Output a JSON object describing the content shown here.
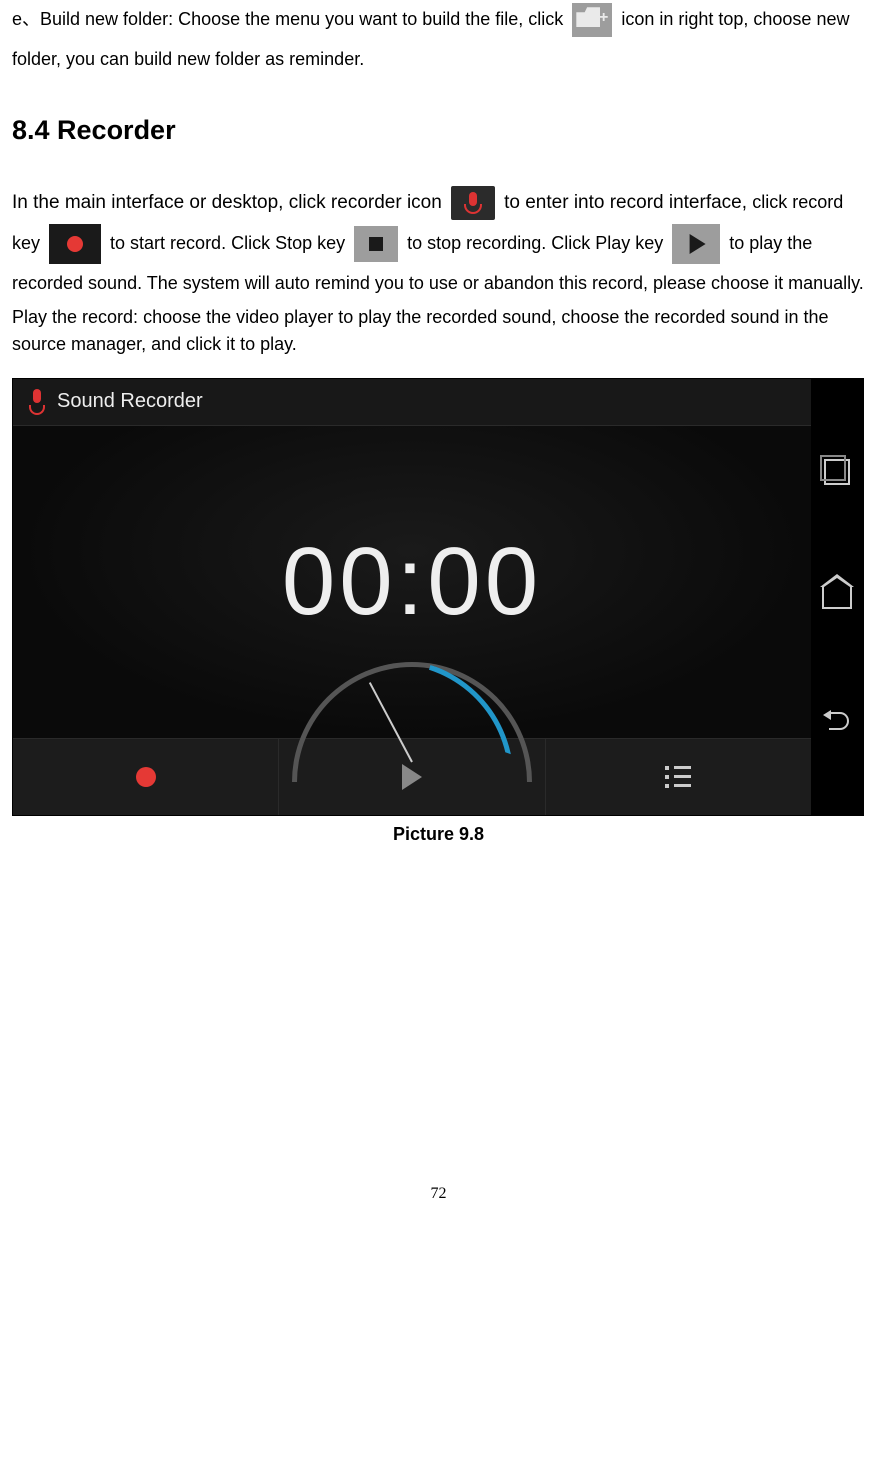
{
  "intro": {
    "prefix": "e、Build new folder: Choose the menu you want to build the file, click ",
    "suffix": " icon in right top, choose new folder, you can build new folder as reminder."
  },
  "heading": "8.4 Recorder",
  "body": {
    "p1a": "In the main interface or desktop, click recorder icon ",
    "p1b": " to enter into record interface, ",
    "p1c": "click record key ",
    "p1d": " to start record. Click Stop key ",
    "p1e": " to stop recording. Click Play key ",
    "p1f": " to play the recorded sound. The system will auto remind you to use or abandon this record, please choose it manually.",
    "p2": "Play the record: choose the video player to play the recorded sound, choose the recorded sound in the source manager, and click it to play."
  },
  "screenshot": {
    "title": "Sound Recorder",
    "timer": "00:00"
  },
  "caption": "Picture 9.8",
  "page_number": "72"
}
